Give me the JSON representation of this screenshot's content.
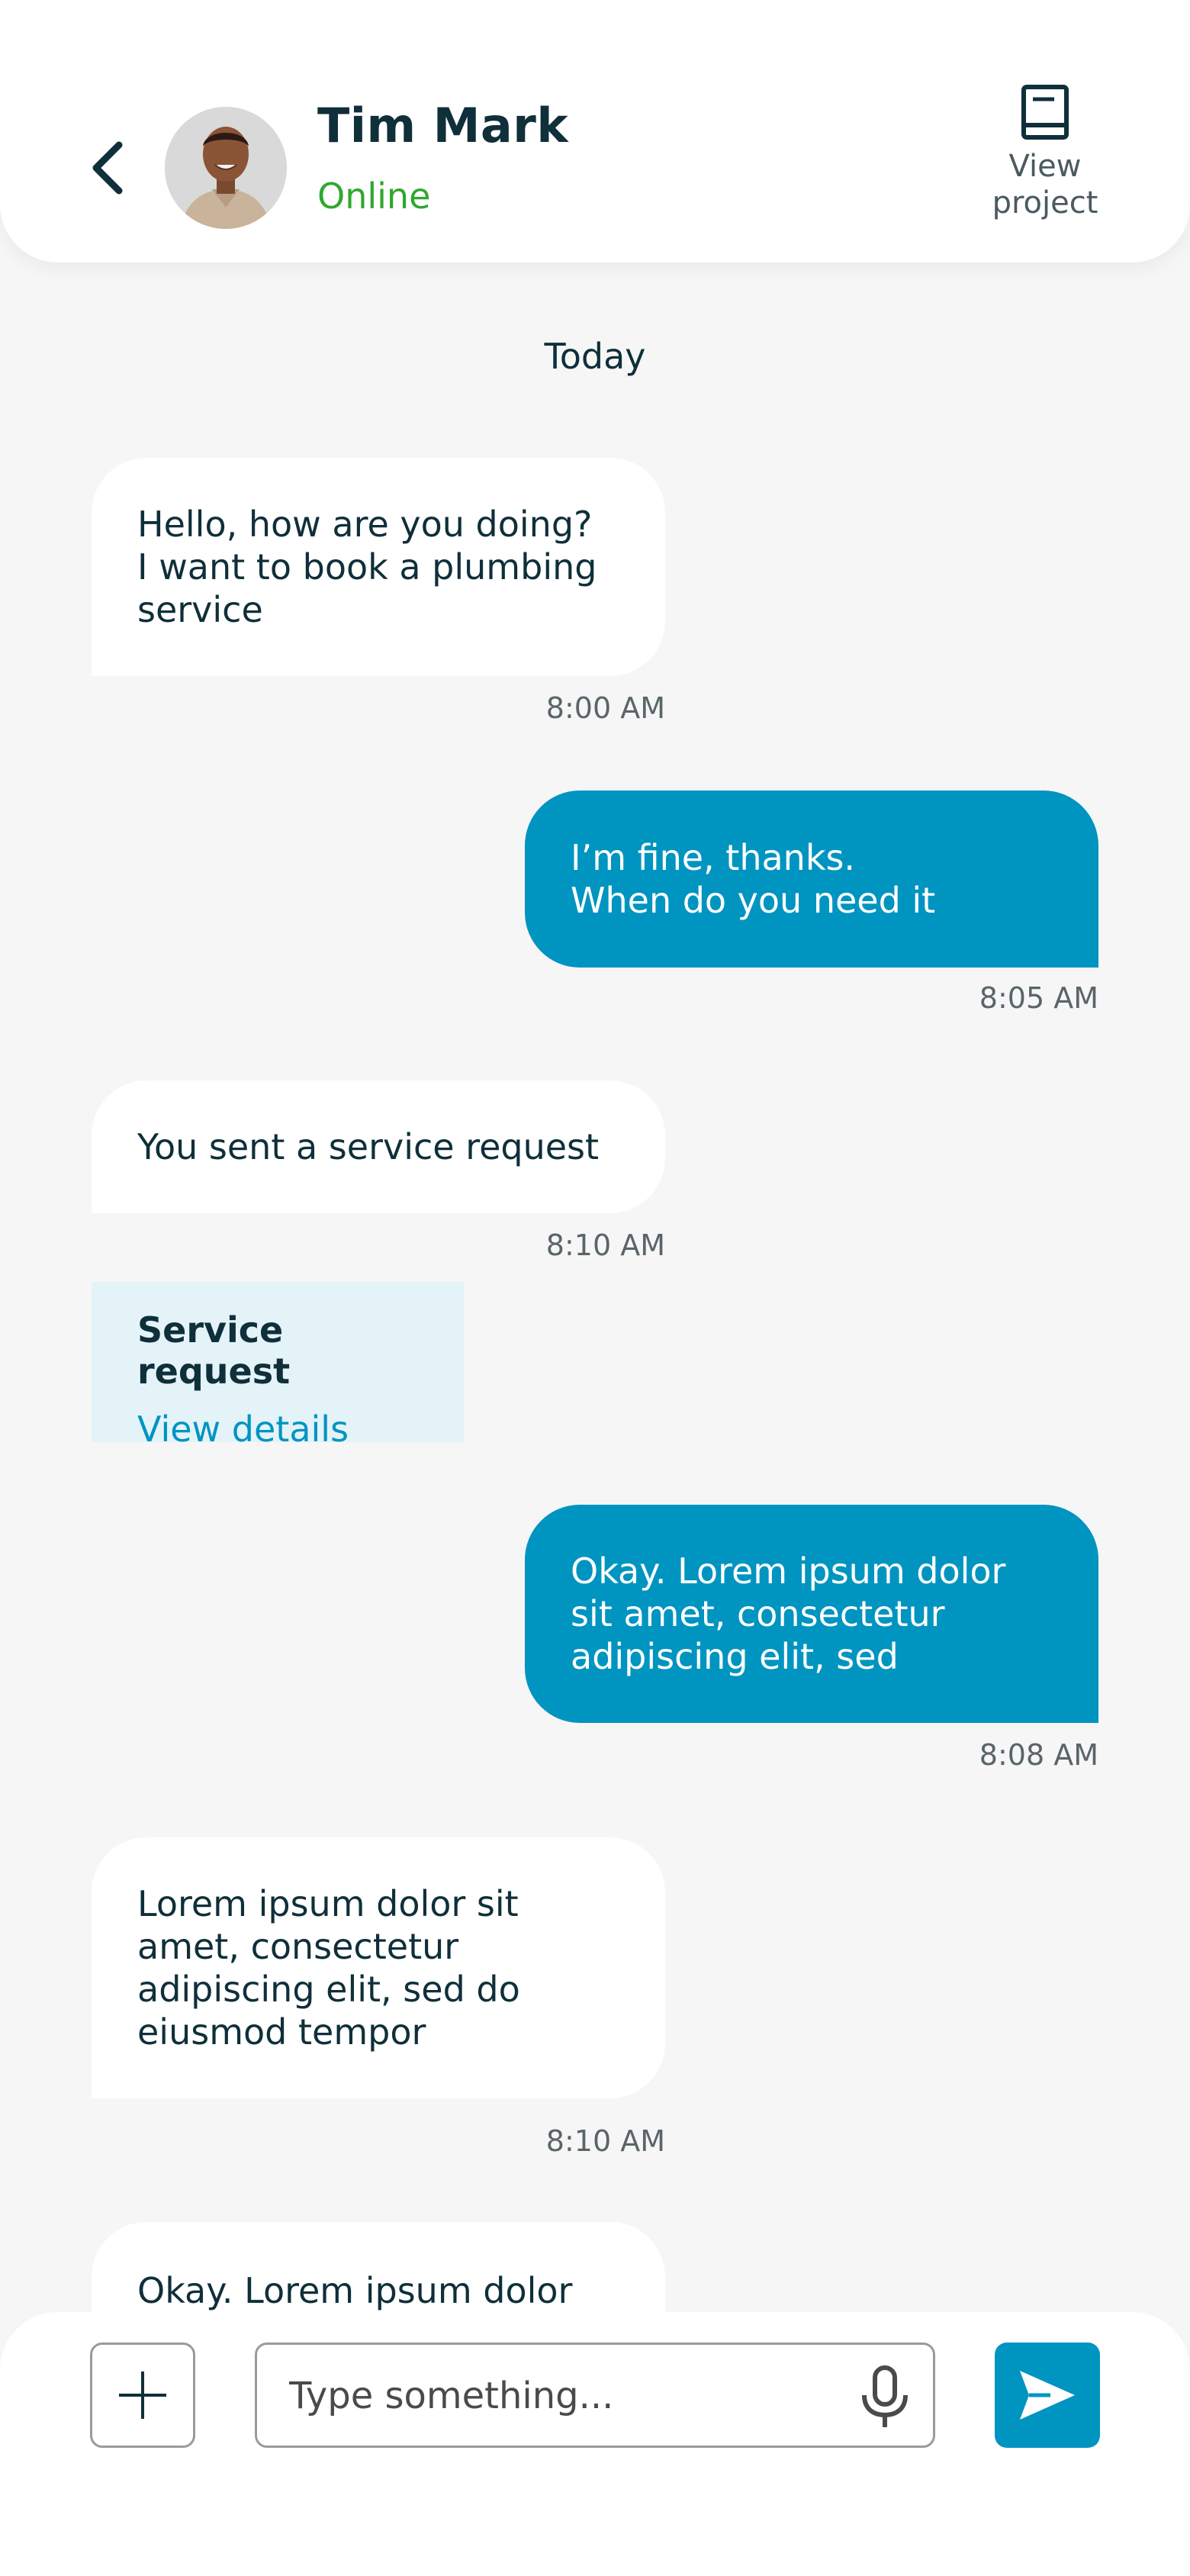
{
  "header": {
    "contact_name": "Tim Mark",
    "status": "Online",
    "view_project_line1": "View",
    "view_project_line2": "project"
  },
  "day_label": "Today",
  "messages": [
    {
      "direction": "in",
      "lines": [
        "Hello, how are you doing?",
        "I want to book a plumbing",
        "service"
      ],
      "time": "8:00 AM"
    },
    {
      "direction": "out",
      "lines": [
        "I’m fine, thanks.",
        "When do you need it"
      ],
      "time": "8:05 AM"
    },
    {
      "direction": "in",
      "lines": [
        "You sent a service request"
      ],
      "time": "8:10 AM"
    },
    {
      "direction": "out",
      "lines": [
        "Okay. Lorem ipsum dolor",
        "sit amet, consectetur",
        "adipiscing elit, sed"
      ],
      "time": "8:08 AM"
    },
    {
      "direction": "in",
      "lines": [
        "Lorem ipsum dolor sit",
        "amet, consectetur",
        "adipiscing elit, sed do",
        "eiusmod tempor"
      ],
      "time": "8:10 AM"
    },
    {
      "direction": "in",
      "lines": [
        "Okay. Lorem ipsum dolor"
      ],
      "time": ""
    }
  ],
  "service_card": {
    "title": "Service request",
    "link": "View details"
  },
  "composer": {
    "placeholder": "Type something..."
  },
  "colors": {
    "accent": "#0094c1",
    "online": "#2fa82d",
    "background": "#f6f6f6",
    "card": "#e4f3f8"
  },
  "icons": [
    "back-arrow-icon",
    "book-icon",
    "plus-icon",
    "microphone-icon",
    "send-icon"
  ]
}
